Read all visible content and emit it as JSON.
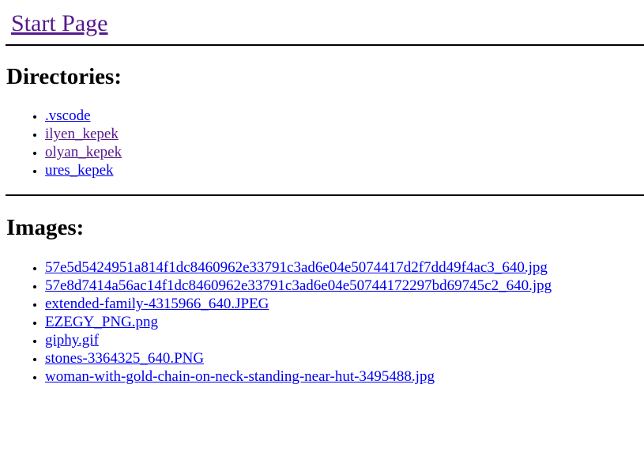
{
  "header": {
    "start_link": "Start Page"
  },
  "directories": {
    "heading": "Directories:",
    "items": [
      {
        "label": ".vscode",
        "visited": false
      },
      {
        "label": "ilyen_kepek",
        "visited": true
      },
      {
        "label": "olyan_kepek",
        "visited": true
      },
      {
        "label": "ures_kepek",
        "visited": false
      }
    ]
  },
  "images": {
    "heading": "Images:",
    "items": [
      {
        "label": "57e5d5424951a814f1dc8460962e33791c3ad6e04e5074417d2f7dd49f4ac3_640.jpg"
      },
      {
        "label": "57e8d7414a56ac14f1dc8460962e33791c3ad6e04e50744172297bd69745c2_640.jpg"
      },
      {
        "label": "extended-family-4315966_640.JPEG"
      },
      {
        "label": "EZEGY_PNG.png"
      },
      {
        "label": "giphy.gif"
      },
      {
        "label": "stones-3364325_640.PNG"
      },
      {
        "label": "woman-with-gold-chain-on-neck-standing-near-hut-3495488.jpg"
      }
    ]
  },
  "colors": {
    "link_unvisited": "#0000ee",
    "link_visited": "#551a8b",
    "rule": "#000000",
    "background": "#ffffff"
  }
}
